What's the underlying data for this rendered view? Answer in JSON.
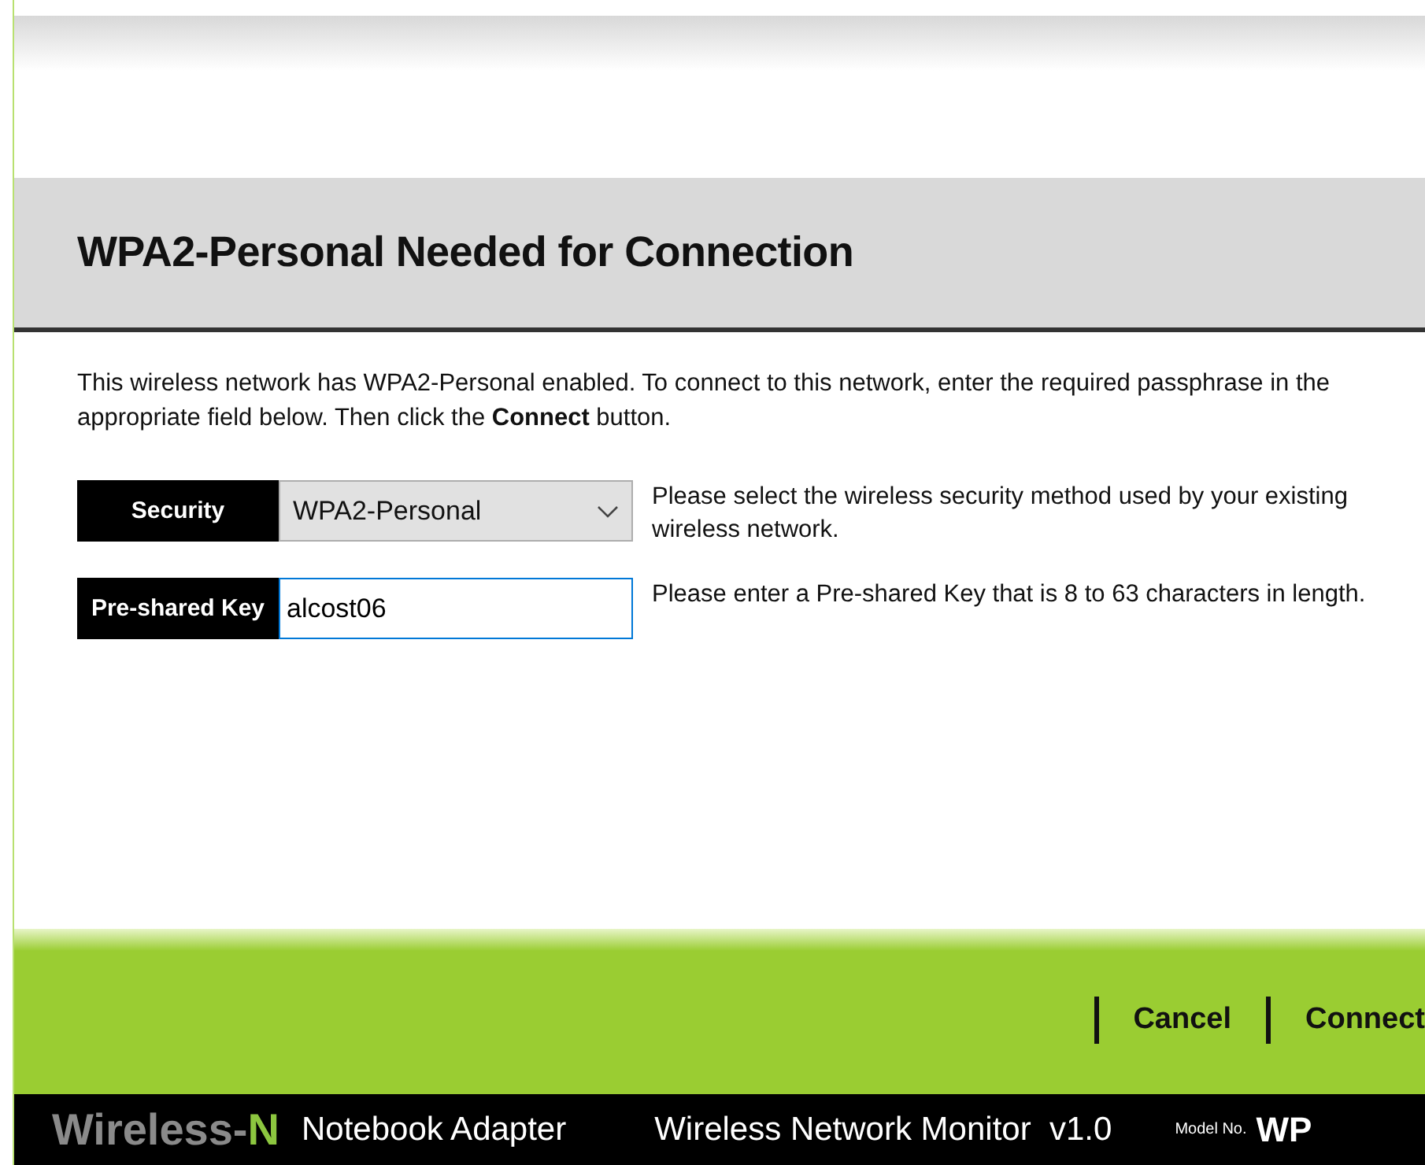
{
  "dialog": {
    "title": "WPA2-Personal Needed for Connection",
    "description": "This wireless network has WPA2-Personal enabled. To connect to this network, enter the required passphrase in the appropriate field below. Then click the **Connect** button.",
    "fields": [
      {
        "kind": "select",
        "label": "Security",
        "value": "WPA2-Personal",
        "help": "Please select the wireless security method used by your existing wireless network."
      },
      {
        "kind": "text",
        "label": "Pre-shared Key",
        "value": "alcost06",
        "focused": true,
        "help": "Please enter a Pre-shared Key that is 8 to 63 characters in length."
      }
    ],
    "buttons": [
      "Cancel",
      "Connect"
    ]
  },
  "footer": {
    "brand": "Wireless-",
    "brand_suffix": "N",
    "product": "Notebook Adapter",
    "app": "Wireless Network Monitor  v1.0",
    "model_label": "Model No.",
    "model": "WP"
  }
}
